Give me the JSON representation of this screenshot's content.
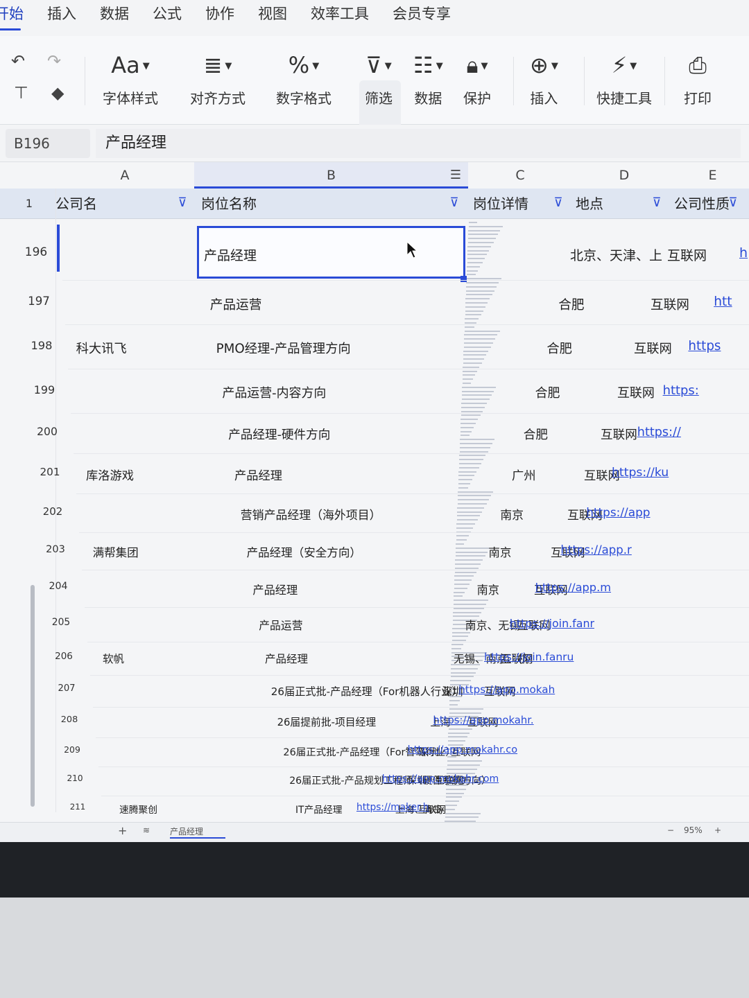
{
  "menu": {
    "items": [
      "开始",
      "插入",
      "数据",
      "公式",
      "协作",
      "视图",
      "效率工具",
      "会员专享"
    ],
    "active_index": 0
  },
  "toolbar": {
    "font_style": "字体样式",
    "align": "对齐方式",
    "number_format": "数字格式",
    "filter": "筛选",
    "data": "数据",
    "protect": "保护",
    "insert": "插入",
    "quick_tools": "快捷工具",
    "print": "打印",
    "font_icon_text": "Aa",
    "percent_icon_text": "%"
  },
  "formula_bar": {
    "cell_ref": "B196",
    "value": "产品经理"
  },
  "columns": [
    "A",
    "B",
    "C",
    "D",
    "E"
  ],
  "header_row": {
    "row_number": "1",
    "company": "公司名",
    "position": "岗位名称",
    "detail": "岗位详情",
    "location": "地点",
    "nature": "公司性质"
  },
  "rows": [
    {
      "num": "196",
      "company": "",
      "position": "产品经理",
      "location": "北京、天津、上",
      "nature": "互联网",
      "link": "h"
    },
    {
      "num": "197",
      "company": "",
      "position": "产品运营",
      "location": "合肥",
      "nature": "互联网",
      "link": "htt"
    },
    {
      "num": "198",
      "company": "科大讯飞",
      "position": "PMO经理-产品管理方向",
      "location": "合肥",
      "nature": "互联网",
      "link": "https"
    },
    {
      "num": "199",
      "company": "",
      "position": "产品运营-内容方向",
      "location": "合肥",
      "nature": "互联网",
      "link": "https:"
    },
    {
      "num": "200",
      "company": "",
      "position": "产品经理-硬件方向",
      "location": "合肥",
      "nature": "互联网",
      "link": "https://"
    },
    {
      "num": "201",
      "company": "库洛游戏",
      "position": "产品经理",
      "location": "广州",
      "nature": "互联网",
      "link": "https://ku"
    },
    {
      "num": "202",
      "company": "",
      "position": "营销产品经理（海外项目）",
      "location": "南京",
      "nature": "互联网",
      "link": "https://app"
    },
    {
      "num": "203",
      "company": "满帮集团",
      "position": "产品经理（安全方向）",
      "location": "南京",
      "nature": "互联网",
      "link": "https://app.r"
    },
    {
      "num": "204",
      "company": "",
      "position": "产品经理",
      "location": "南京",
      "nature": "互联网",
      "link": "https://app.m"
    },
    {
      "num": "205",
      "company": "",
      "position": "产品运营",
      "location": "南京、无锡",
      "nature": "互联网",
      "link": "https://join.fanr"
    },
    {
      "num": "206",
      "company": "软帆",
      "position": "产品经理",
      "location": "无锡、南京、杭",
      "nature": "互联网",
      "link": "https://join.fanru"
    },
    {
      "num": "207",
      "company": "",
      "position": "26届正式批-产品经理（For机器人行业）",
      "location": "深圳",
      "nature": "互联网",
      "link": "https://app.mokah"
    },
    {
      "num": "208",
      "company": "",
      "position": "26届提前批-项目经理",
      "location": "上海",
      "nature": "互联网",
      "link": "https://app.mokahr."
    },
    {
      "num": "209",
      "company": "",
      "position": "26届正式批-产品经理（For智驾行业）",
      "location": "深圳",
      "nature": "互联网",
      "link": "https://app.mokahr.co"
    },
    {
      "num": "210",
      "company": "",
      "position": "26届正式批-产品规划工程师（硬件系统方向）",
      "location": "深圳",
      "nature": "互联网",
      "link": "https://app.mokahr.com"
    },
    {
      "num": "211",
      "company": "速腾聚创",
      "position": "IT产品经理",
      "location": "上海、青岛",
      "nature": "互联网",
      "link": "https://maker.h"
    }
  ],
  "sheet_tab": "产品经理",
  "zoom": "95%",
  "colors": {
    "accent": "#2a4bd7",
    "header_bg": "#dfe6f2"
  }
}
